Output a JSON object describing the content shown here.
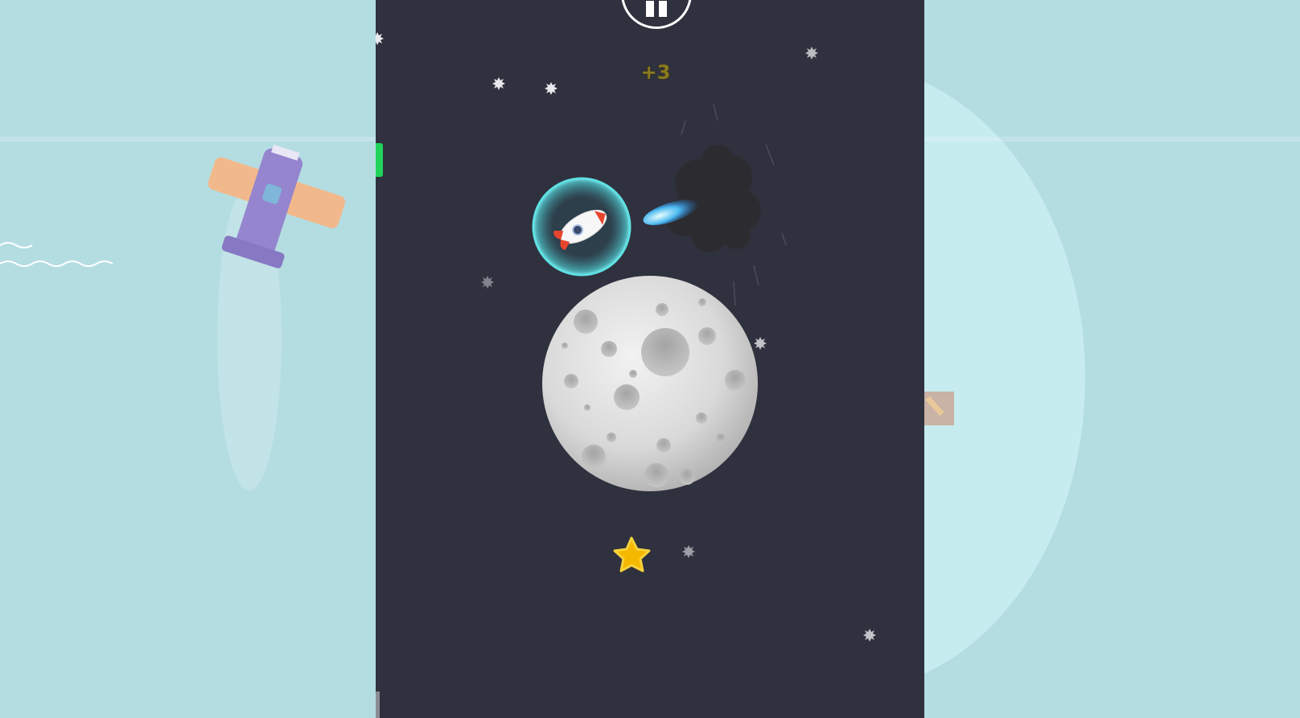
{
  "hud": {
    "score_popup": "+3",
    "pause_icon": "pause-icon",
    "fuel_level": 0.2
  },
  "scene": {
    "player": "rocket-ship",
    "shield": "bubble-shield",
    "planet": "moon",
    "collectible": "gold-star",
    "hazard": "smoke-cloud"
  },
  "colors": {
    "space_bg": "#30313e",
    "side_bg": "#b4dde2",
    "fuel_bar": "#22d35a",
    "score_text": "#8a7a1e",
    "shield": "#4fd1d6",
    "star": "#f5b800"
  }
}
